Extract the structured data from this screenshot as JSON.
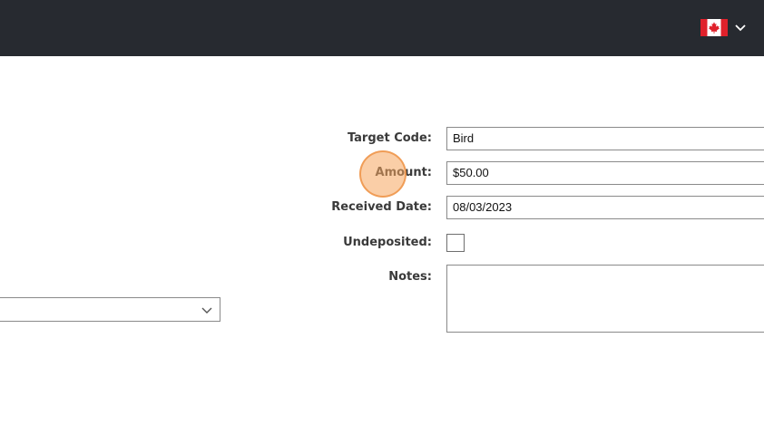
{
  "header": {
    "flag_icon": "canada-flag-icon",
    "flag_menu_icon": "chevron-down-icon",
    "background_color": "#272a30"
  },
  "form": {
    "target_code": {
      "label": "Target Code:",
      "value": "Bird"
    },
    "amount": {
      "label": "Amount:",
      "value": "$50.00"
    },
    "received_date": {
      "label": "Received Date:",
      "value": "08/03/2023"
    },
    "undeposited": {
      "label": "Undeposited:",
      "checked": false
    },
    "notes": {
      "label": "Notes:",
      "value": ""
    }
  },
  "left_panel": {
    "select_value": "",
    "select_icon": "chevron-down-icon"
  },
  "overlay": {
    "click_indicator_color": "#f5a55f"
  }
}
